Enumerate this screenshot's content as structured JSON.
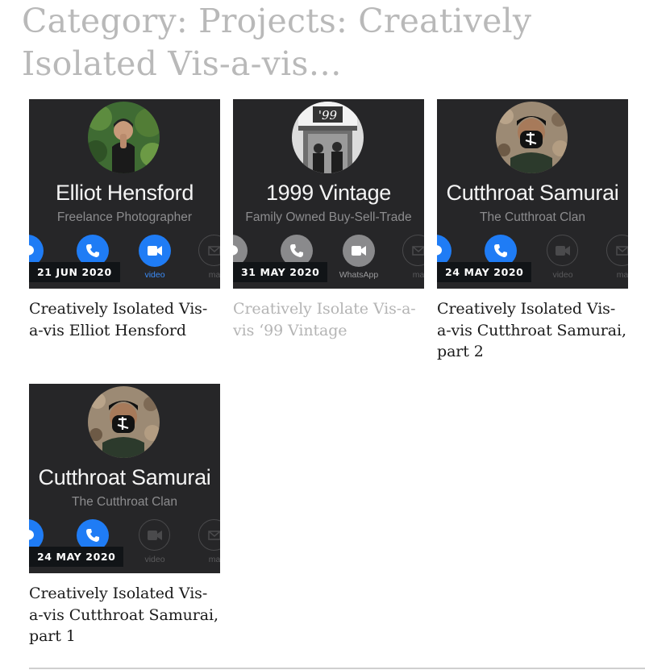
{
  "category": {
    "title": "Category: Projects: Creatively Isolated Vis-a-vis…"
  },
  "posts": [
    {
      "date": "21 JUN 2020",
      "title": "Creatively Isolated Vis-a-vis Elliot Hensford",
      "contact_name": "Elliot Hensford",
      "contact_subtitle": "Freelance Photographer",
      "active_label": "video",
      "faded_label": "ma",
      "avatar": "person-hands-together-plants-photo"
    },
    {
      "date": "31 MAY 2020",
      "title": "Creatively Isolate Vis-a-vis ‘99 Vintage",
      "contact_name": "1999 Vintage",
      "contact_subtitle": "Family Owned Buy-Sell-Trade",
      "active_label": "WhatsApp",
      "faded_label": "ma",
      "avatar": "storefront-99-bw-photo"
    },
    {
      "date": "24 MAY 2020",
      "title": "Creatively Isolated Vis-a-vis Cutthroat Samurai, part 2",
      "contact_name": "Cutthroat Samurai",
      "contact_subtitle": "The Cutthroat Clan",
      "active_label": "video",
      "faded_label": "ma",
      "avatar": "masked-person-photo"
    },
    {
      "date": "24 MAY 2020",
      "title": "Creatively Isolated Vis-a-vis Cutthroat Samurai, part 1",
      "contact_name": "Cutthroat Samurai",
      "contact_subtitle": "The Cutthroat Clan",
      "active_label": "video",
      "faded_label": "ma",
      "avatar": "masked-person-photo"
    }
  ],
  "colors": {
    "title_grey": "#b9b9b9",
    "thumb_bg": "#262628",
    "ios_blue": "#1f7cf5",
    "badge_bg": "#111417"
  }
}
